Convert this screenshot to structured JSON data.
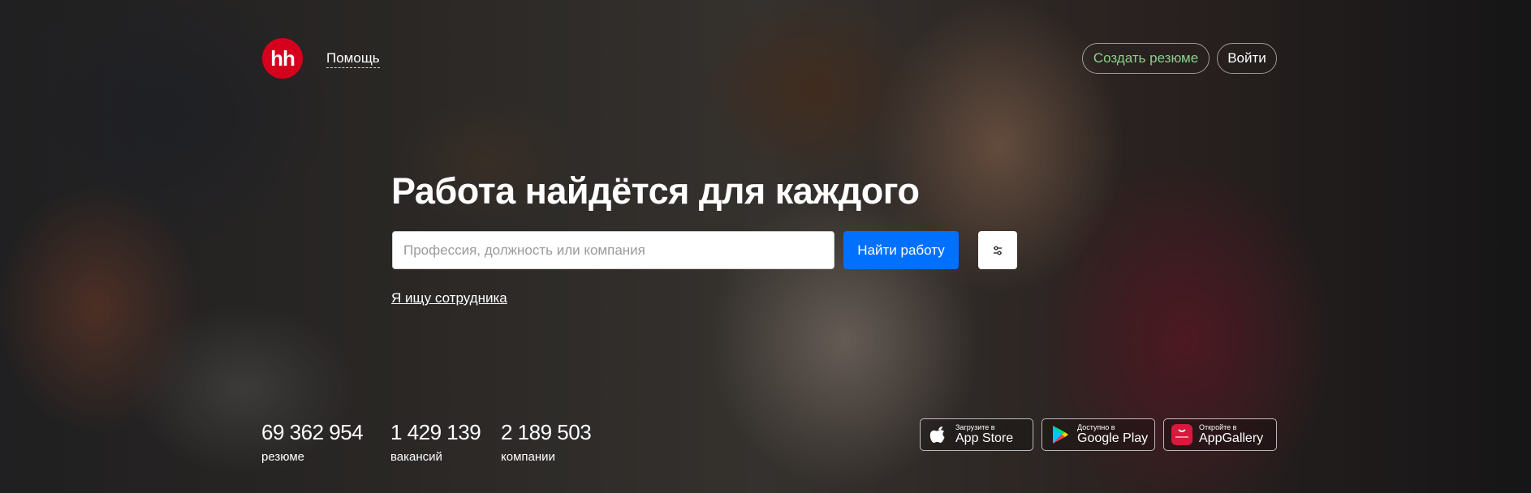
{
  "header": {
    "logo_text": "hh",
    "help": "Помощь",
    "create_resume": "Создать резюме",
    "login": "Войти"
  },
  "hero": {
    "title": "Работа найдётся для каждого",
    "search_placeholder": "Профессия, должность или компания",
    "find_button": "Найти работу",
    "employer_link": "Я ищу сотрудника"
  },
  "stats": [
    {
      "value": "69 362 954",
      "label": "резюме"
    },
    {
      "value": "1 429 139",
      "label": "вакансий"
    },
    {
      "value": "2 189 503",
      "label": "компании"
    }
  ],
  "stores": [
    {
      "small": "Загрузите в",
      "name": "App Store",
      "icon": "apple-icon"
    },
    {
      "small": "Доступно в",
      "name": "Google Play",
      "icon": "google-play-icon"
    },
    {
      "small": "Откройте в",
      "name": "AppGallery",
      "icon": "huawei-appgallery-icon"
    }
  ],
  "colors": {
    "brand_red": "#d6001c",
    "primary_blue": "#0070ff",
    "create_green": "#8ad08a"
  }
}
